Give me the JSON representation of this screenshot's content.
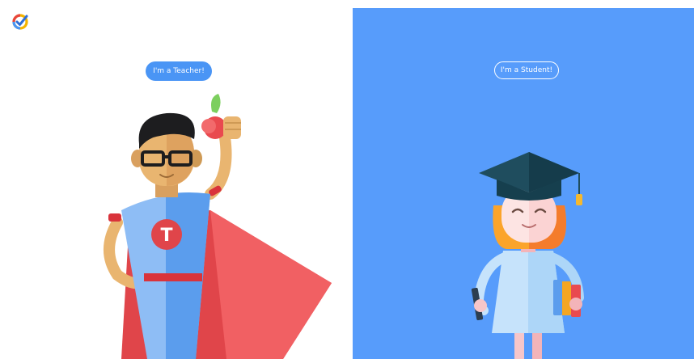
{
  "app": {
    "logo_icon": "checkmark-circle-logo-icon"
  },
  "teacher_panel": {
    "button_label": "I'm a Teacher!",
    "accent": "#4a95f5",
    "illustration_icon": "superhero-teacher-illustration"
  },
  "student_panel": {
    "button_label": "I'm a Student!",
    "background": "#579cfb",
    "illustration_icon": "graduate-student-illustration"
  }
}
